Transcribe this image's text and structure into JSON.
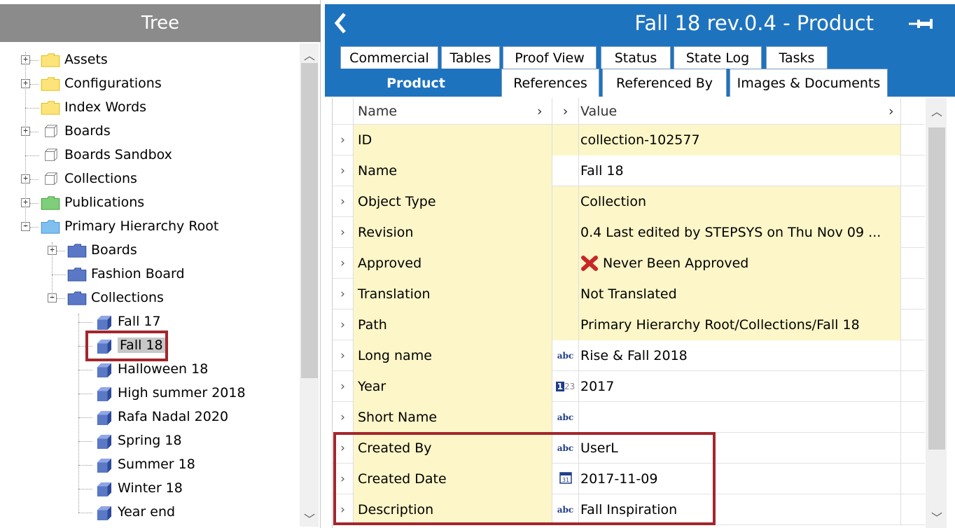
{
  "tree": {
    "title": "Tree",
    "nodes": [
      {
        "label": "Assets",
        "folder": "yellow",
        "expander": "+"
      },
      {
        "label": "Configurations",
        "folder": "yellow",
        "expander": "+"
      },
      {
        "label": "Index Words",
        "folder": "yellow",
        "expander": ""
      },
      {
        "label": "Boards",
        "folder": "cube-gray",
        "expander": "+"
      },
      {
        "label": "Boards Sandbox",
        "folder": "cube-gray",
        "expander": ""
      },
      {
        "label": "Collections",
        "folder": "cube-gray",
        "expander": "+"
      },
      {
        "label": "Publications",
        "folder": "green",
        "expander": "+"
      },
      {
        "label": "Primary Hierarchy Root",
        "folder": "blue",
        "expander": "-"
      },
      {
        "label": "Boards",
        "folder": "navy",
        "expander": "+"
      },
      {
        "label": "Fashion Board",
        "folder": "navy",
        "expander": ""
      },
      {
        "label": "Collections",
        "folder": "navy",
        "expander": "-"
      },
      {
        "label": "Fall 17",
        "folder": "cube-blue",
        "expander": ""
      },
      {
        "label": "Fall 18",
        "folder": "cube-blue",
        "expander": "",
        "selected": true
      },
      {
        "label": "Halloween 18",
        "folder": "cube-blue",
        "expander": ""
      },
      {
        "label": "High summer 2018",
        "folder": "cube-blue",
        "expander": ""
      },
      {
        "label": "Rafa Nadal 2020",
        "folder": "cube-blue",
        "expander": ""
      },
      {
        "label": "Spring 18",
        "folder": "cube-blue",
        "expander": ""
      },
      {
        "label": "Summer 18",
        "folder": "cube-blue",
        "expander": ""
      },
      {
        "label": "Winter 18",
        "folder": "cube-blue",
        "expander": ""
      },
      {
        "label": "Year end",
        "folder": "cube-blue",
        "expander": ""
      }
    ]
  },
  "header": {
    "title": "Fall 18 rev.0.4 - Product",
    "back_icon": "chevron-left-icon",
    "pin_icon": "pin-icon"
  },
  "tabs": {
    "row1": [
      "Commercial",
      "Tables",
      "Proof View",
      "Status",
      "State Log",
      "Tasks"
    ],
    "row2": [
      "Product",
      "References",
      "Referenced By",
      "Images & Documents"
    ],
    "active": "Product"
  },
  "grid": {
    "columns": {
      "name": "Name",
      "value": "Value"
    },
    "rows": [
      {
        "name": "ID",
        "type": "",
        "value": "collection-102577",
        "yellow": true
      },
      {
        "name": "Name",
        "type": "",
        "value": "Fall 18",
        "yellow": false
      },
      {
        "name": "Object Type",
        "type": "",
        "value": "Collection",
        "yellow": true
      },
      {
        "name": "Revision",
        "type": "",
        "value": "0.4 Last edited by STEPSYS on Thu Nov 09 ...",
        "yellow": true
      },
      {
        "name": "Approved",
        "type": "",
        "value": "Never Been Approved",
        "yellow": true,
        "value_icon": "red-x-icon"
      },
      {
        "name": "Translation",
        "type": "",
        "value": "Not Translated",
        "yellow": true
      },
      {
        "name": "Path",
        "type": "",
        "value": "Primary Hierarchy Root/Collections/Fall 18",
        "yellow": true
      },
      {
        "name": "Long name",
        "type": "abc",
        "value": "Rise & Fall 2018",
        "yellow": false
      },
      {
        "name": "Year",
        "type": "123",
        "value": "2017",
        "yellow": false
      },
      {
        "name": "Short Name",
        "type": "abc",
        "value": "",
        "yellow": false
      },
      {
        "name": "Created By",
        "type": "abc",
        "value": "UserL",
        "yellow": false
      },
      {
        "name": "Created Date",
        "type": "calendar",
        "value": "2017-11-09",
        "yellow": false
      },
      {
        "name": "Description",
        "type": "abc",
        "value": "Fall Inspiration",
        "yellow": false
      }
    ]
  },
  "type_icons": {
    "abc": "abc",
    "num_sup": "23",
    "calendar_day": "31"
  },
  "colors": {
    "header_blue": "#1e73be",
    "tree_header_gray": "#8b8b8b",
    "yellow_cell": "#fcf6c8",
    "highlight_red": "#a4262c"
  }
}
